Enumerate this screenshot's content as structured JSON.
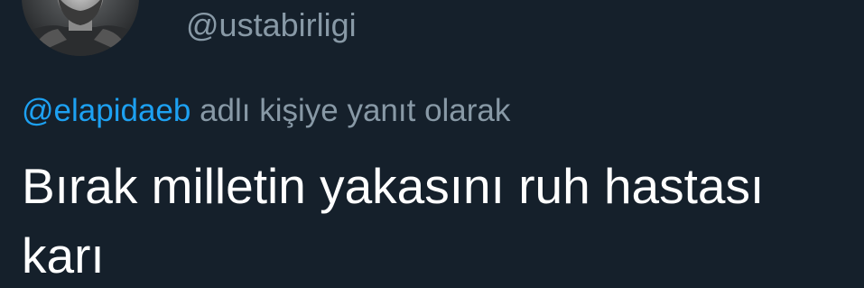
{
  "colors": {
    "background": "#15202b",
    "secondary_text": "#8899a6",
    "mention": "#1da1f2",
    "primary_text": "#ffffff"
  },
  "author": {
    "avatar_icon": "user-avatar-photo",
    "handle": "@ustabirligi"
  },
  "reply_context": {
    "mention": "@elapidaeb",
    "suffix": " adlı kişiye yanıt olarak"
  },
  "tweet": {
    "text": "Bırak milletin yakasını ruh hastası karı"
  }
}
